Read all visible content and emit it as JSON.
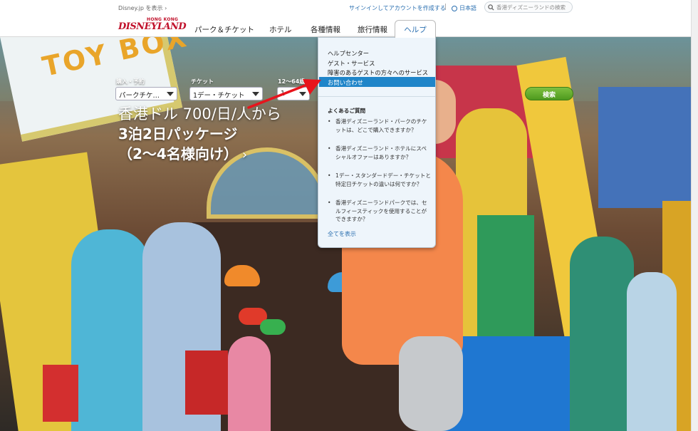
{
  "header": {
    "disney_link": "Disney.jp を表示 ›",
    "signin": "サインインしてアカウントを作成する",
    "separator": "|",
    "language": "日本語",
    "search_placeholder": "香港ディズニーランドの検索",
    "logo_top": "HONG KONG",
    "logo_main": "DISNEYLAND"
  },
  "nav": {
    "items": [
      "パーク＆チケット",
      "ホテル",
      "各種情報",
      "旅行情報"
    ],
    "help": "ヘルプ"
  },
  "booking": {
    "labels": [
      "購入・予約",
      "チケット",
      "12〜64歳"
    ],
    "values": [
      "パークチケ…",
      "1デー・チケット",
      "1"
    ],
    "search_button": "検索"
  },
  "hero": {
    "line1": "香港ドル 700/日/人から",
    "line2": "3泊2日パッケージ",
    "line3": "（2〜4名様向け）",
    "chevron": "›",
    "sign_text": "TOY BOX"
  },
  "dropdown": {
    "links": [
      "ヘルプセンター",
      "ゲスト・サービス",
      "障害のあるゲストの方々へのサービス"
    ],
    "active": "お問い合わせ",
    "faq_title": "よくあるご質問",
    "faqs": [
      "香港ディズニーランド・パークのチケットは、どこで購入できますか？",
      "香港ディズニーランド・ホテルにスペシャルオファーはありますか？",
      "1デー・スタンダードデー・チケットと特定日チケットの違いは何ですか？",
      "香港ディズニーランドパークでは、セルフィースティックを使用することができますか？"
    ],
    "view_all": "全てを表示"
  },
  "colors": {
    "brand_red": "#c0102a",
    "link_blue": "#2a6fb0",
    "active_blue": "#1f85c9",
    "search_green": "#5fa82a",
    "annotation_red": "#e8141c"
  }
}
